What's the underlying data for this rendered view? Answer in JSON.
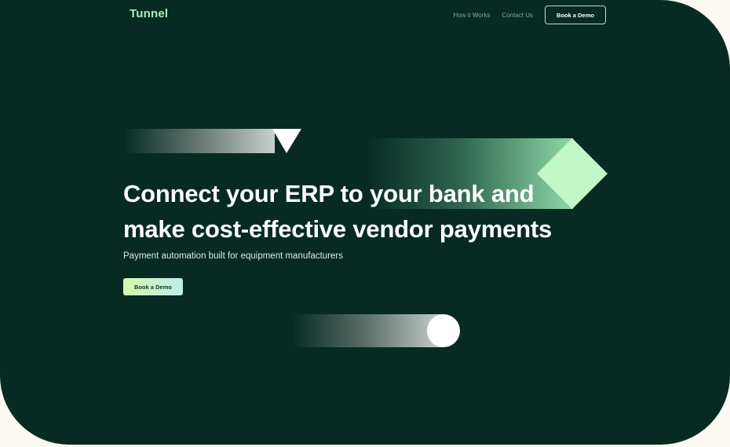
{
  "brand": {
    "logo_text": "Tunnel"
  },
  "nav": {
    "links": [
      "How it Works",
      "Contact Us"
    ],
    "cta_label": "Book a Demo"
  },
  "hero": {
    "headline_lines": [
      "Connect your ERP to your bank and",
      "make cost-effective vendor payments"
    ],
    "subheadline": "Payment automation built for equipment manufacturers",
    "cta_label": "Book a Demo"
  },
  "colors": {
    "background": "#072b23",
    "brand_accent": "#a6f0b8",
    "diamond": "#c2f7c8",
    "text": "#ffffff"
  },
  "decorations": [
    "triangle-shape",
    "diamond-shape",
    "circle-shape"
  ]
}
